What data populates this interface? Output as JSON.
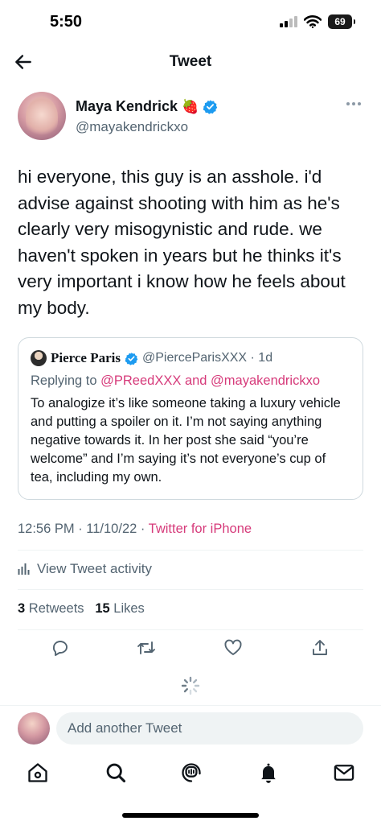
{
  "status": {
    "time": "5:50",
    "battery": "69"
  },
  "header": {
    "title": "Tweet"
  },
  "tweet": {
    "author": {
      "name": "Maya Kendrick",
      "emoji": "🍓",
      "handle": "@mayakendrickxo"
    },
    "text": "hi everyone, this guy is an asshole. i'd advise against shooting with him as he's clearly very misogynistic and rude. we haven't spoken in years but he thinks it's very important i know how he feels about my body.",
    "quote": {
      "name": "Pierce Paris",
      "meta": "@PierceParisXXX · 1d",
      "replying_prefix": "Replying to ",
      "replying_mentions": "@PReedXXX and @mayakendrickxo",
      "body": "To analogize it’s like someone taking a luxury vehicle and putting a spoiler on it.  I’m not saying anything negative towards it. In her post she said “you’re welcome” and I’m saying it’s not everyone’s cup of tea, including my own."
    },
    "timestamp": "12:56 PM · 11/10/22 · ",
    "client": "Twitter for iPhone",
    "activity_label": "View Tweet activity",
    "retweets_count": "3",
    "retweets_label": "Retweets",
    "likes_count": "15",
    "likes_label": "Likes"
  },
  "actions": {
    "icons": [
      "reply-icon",
      "retweet-icon",
      "like-icon",
      "share-icon"
    ]
  },
  "compose": {
    "placeholder": "Add another Tweet"
  },
  "tabbar": {
    "icons": [
      "home-icon",
      "search-icon",
      "spaces-icon",
      "notifications-icon",
      "messages-icon"
    ]
  },
  "colors": {
    "link": "#d63a7a",
    "verified": "#1d9bf0",
    "secondary_text": "#536471"
  }
}
